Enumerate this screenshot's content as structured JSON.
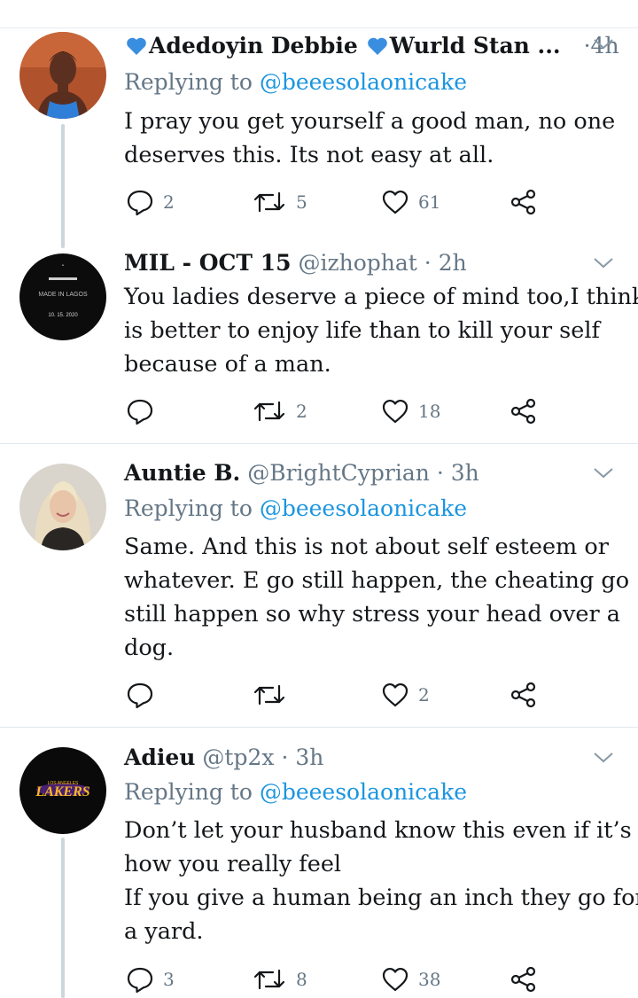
{
  "tweets": [
    {
      "display_name": "Adedoyin Debbie",
      "name_suffix": "Wurld Stan ...",
      "handle": "",
      "dot": "·",
      "time": "4h",
      "replying_prefix": "Replying to",
      "replying_to": "@beeesolaonicake",
      "text_lines": [
        "I pray you get yourself a good man, no one",
        "deserves this. Its not easy at all."
      ],
      "replies": "2",
      "retweets": "5",
      "likes": "61"
    },
    {
      "display_name": "MIL - OCT 15",
      "handle": "@izhophat",
      "dot": "·",
      "time": "2h",
      "avatar_text": [
        "MADE IN LAGOS",
        "10. 15. 2020"
      ],
      "text_lines": [
        "You ladies deserve a piece of mind too,I think",
        "is better to enjoy life than to kill your self",
        "because of a man."
      ],
      "replies": "",
      "retweets": "2",
      "likes": "18"
    },
    {
      "display_name": "Auntie B.",
      "handle": "@BrightCyprian",
      "dot": "·",
      "time": "3h",
      "replying_prefix": "Replying to",
      "replying_to": "@beeesolaonicake",
      "text_lines": [
        "Same. And this is not about self esteem or",
        "whatever. E go still happen, the cheating go",
        "still happen so why stress your head over a",
        "dog."
      ],
      "replies": "",
      "retweets": "",
      "likes": "2"
    },
    {
      "display_name": "Adieu",
      "handle": "@tp2x",
      "dot": "·",
      "time": "3h",
      "avatar_text": [
        "LOS ANGELES",
        "LAKERS"
      ],
      "replying_prefix": "Replying to",
      "replying_to": "@beeesolaonicake",
      "text_lines": [
        "Don’t let your husband know this even if it’s",
        "how you really feel",
        "If you give a human being an inch they go for",
        "a yard."
      ],
      "replies": "3",
      "retweets": "8",
      "likes": "38"
    }
  ],
  "colors": {
    "text": "#14171a",
    "secondary": "#657786",
    "link": "#1b95e0",
    "heart_emoji": "#3a8ee0",
    "divider": "#e1e8ed",
    "thread_line": "#ccd6dd"
  },
  "icons": {
    "reply": "reply-icon",
    "retweet": "retweet-icon",
    "like": "like-icon",
    "share": "share-icon",
    "more": "chevron-down-icon",
    "emoji": "blue-heart-emoji"
  }
}
